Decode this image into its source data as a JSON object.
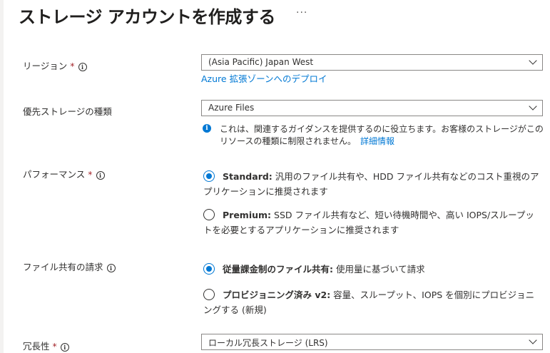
{
  "page": {
    "title": "ストレージ アカウントを作成する",
    "more_label": "···"
  },
  "region": {
    "label": "リージョン",
    "required": "*",
    "info": "i",
    "value": "(Asia Pacific) Japan West",
    "link": "Azure 拡張ゾーンへのデプロイ"
  },
  "primary_storage": {
    "label": "優先ストレージの種類",
    "value": "Azure Files",
    "info_icon": "i",
    "info_text": "これは、関連するガイダンスを提供するのに役立ちます。お客様のストレージがこのリソースの種類に制限されません。",
    "info_link": "詳細情報"
  },
  "performance": {
    "label": "パフォーマンス",
    "required": "*",
    "info": "i",
    "options": [
      {
        "title": "Standard:",
        "desc": " 汎用のファイル共有や、HDD ファイル共有などのコスト重視のアプリケーションに推奨されます",
        "selected": true
      },
      {
        "title": "Premium:",
        "desc": " SSD ファイル共有など、短い待機時間や、高い IOPS/スループットを必要とするアプリケーションに推奨されます",
        "selected": false
      }
    ]
  },
  "billing": {
    "label": "ファイル共有の請求",
    "info": "i",
    "options": [
      {
        "title": "従量課金制のファイル共有:",
        "desc": " 使用量に基づいて請求",
        "selected": true
      },
      {
        "title": "プロビジョニング済み v2:",
        "desc": " 容量、スループット、IOPS を個別にプロビジョニングする (新規)",
        "selected": false
      }
    ]
  },
  "redundancy": {
    "label": "冗長性",
    "required": "*",
    "info": "i",
    "value": "ローカル冗長ストレージ (LRS)"
  },
  "colors": {
    "accent": "#0078d4",
    "required": "#a4262c",
    "border": "#8a8886",
    "text": "#323130"
  },
  "icons": [
    "info-icon",
    "chevron-down-icon",
    "radio-button",
    "more-icon"
  ]
}
